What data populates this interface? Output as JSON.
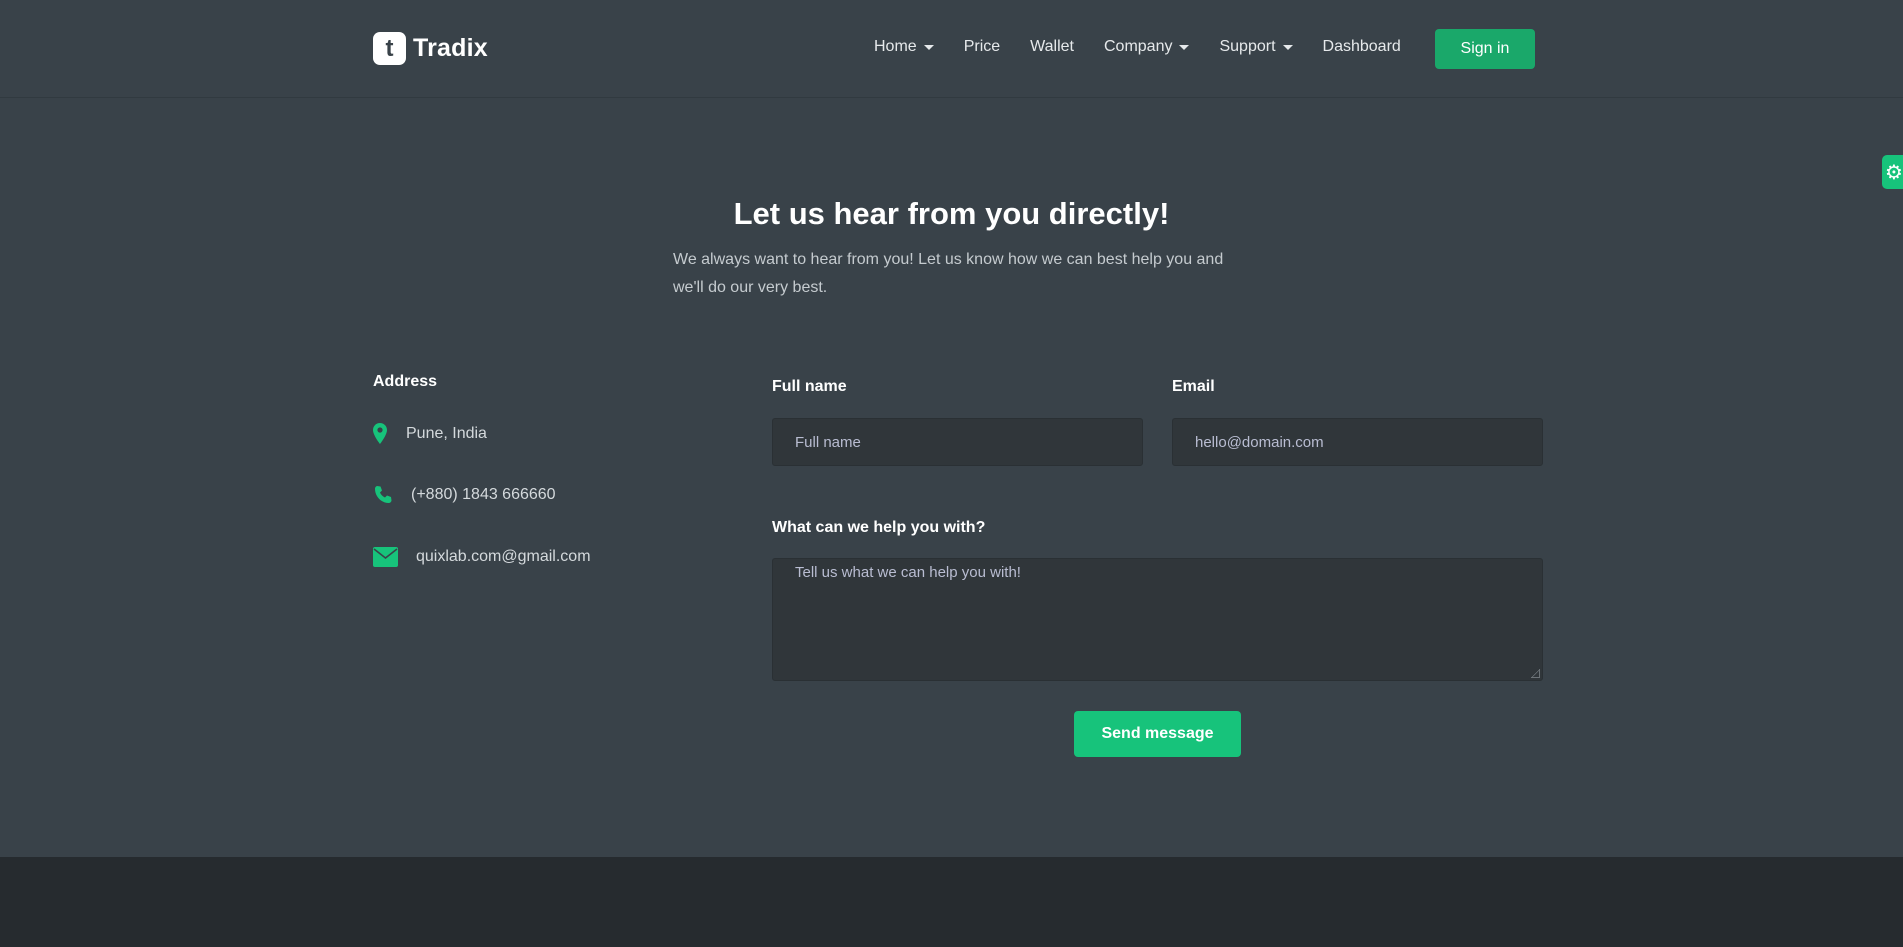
{
  "header": {
    "logo_mark": "t",
    "logo_text": "Tradix",
    "nav": [
      {
        "label": "Home",
        "dropdown": true
      },
      {
        "label": "Price",
        "dropdown": false
      },
      {
        "label": "Wallet",
        "dropdown": false
      },
      {
        "label": "Company",
        "dropdown": true
      },
      {
        "label": "Support",
        "dropdown": true
      },
      {
        "label": "Dashboard",
        "dropdown": false
      }
    ],
    "signin_label": "Sign in"
  },
  "settings_icon": "gear-icon",
  "hero": {
    "title": "Let us hear from you directly!",
    "subtitle": "We always want to hear from you! Let us know how we can best help you and we'll do our very best."
  },
  "contact": {
    "title": "Address",
    "items": [
      {
        "icon": "map-pin-icon",
        "text": "Pune, India"
      },
      {
        "icon": "phone-icon",
        "text": "(+880) 1843 666660"
      },
      {
        "icon": "envelope-icon",
        "text": "quixlab.com@gmail.com"
      }
    ]
  },
  "form": {
    "fullname_label": "Full name",
    "fullname_placeholder": "Full name",
    "email_label": "Email",
    "email_placeholder": "hello@domain.com",
    "message_label": "What can we help you with?",
    "message_placeholder": "Tell us what we can help you with!",
    "submit_label": "Send message"
  },
  "colors": {
    "background": "#394249",
    "accent": "#17c37b",
    "signin": "#1aa86a",
    "footer": "#262b2f"
  }
}
